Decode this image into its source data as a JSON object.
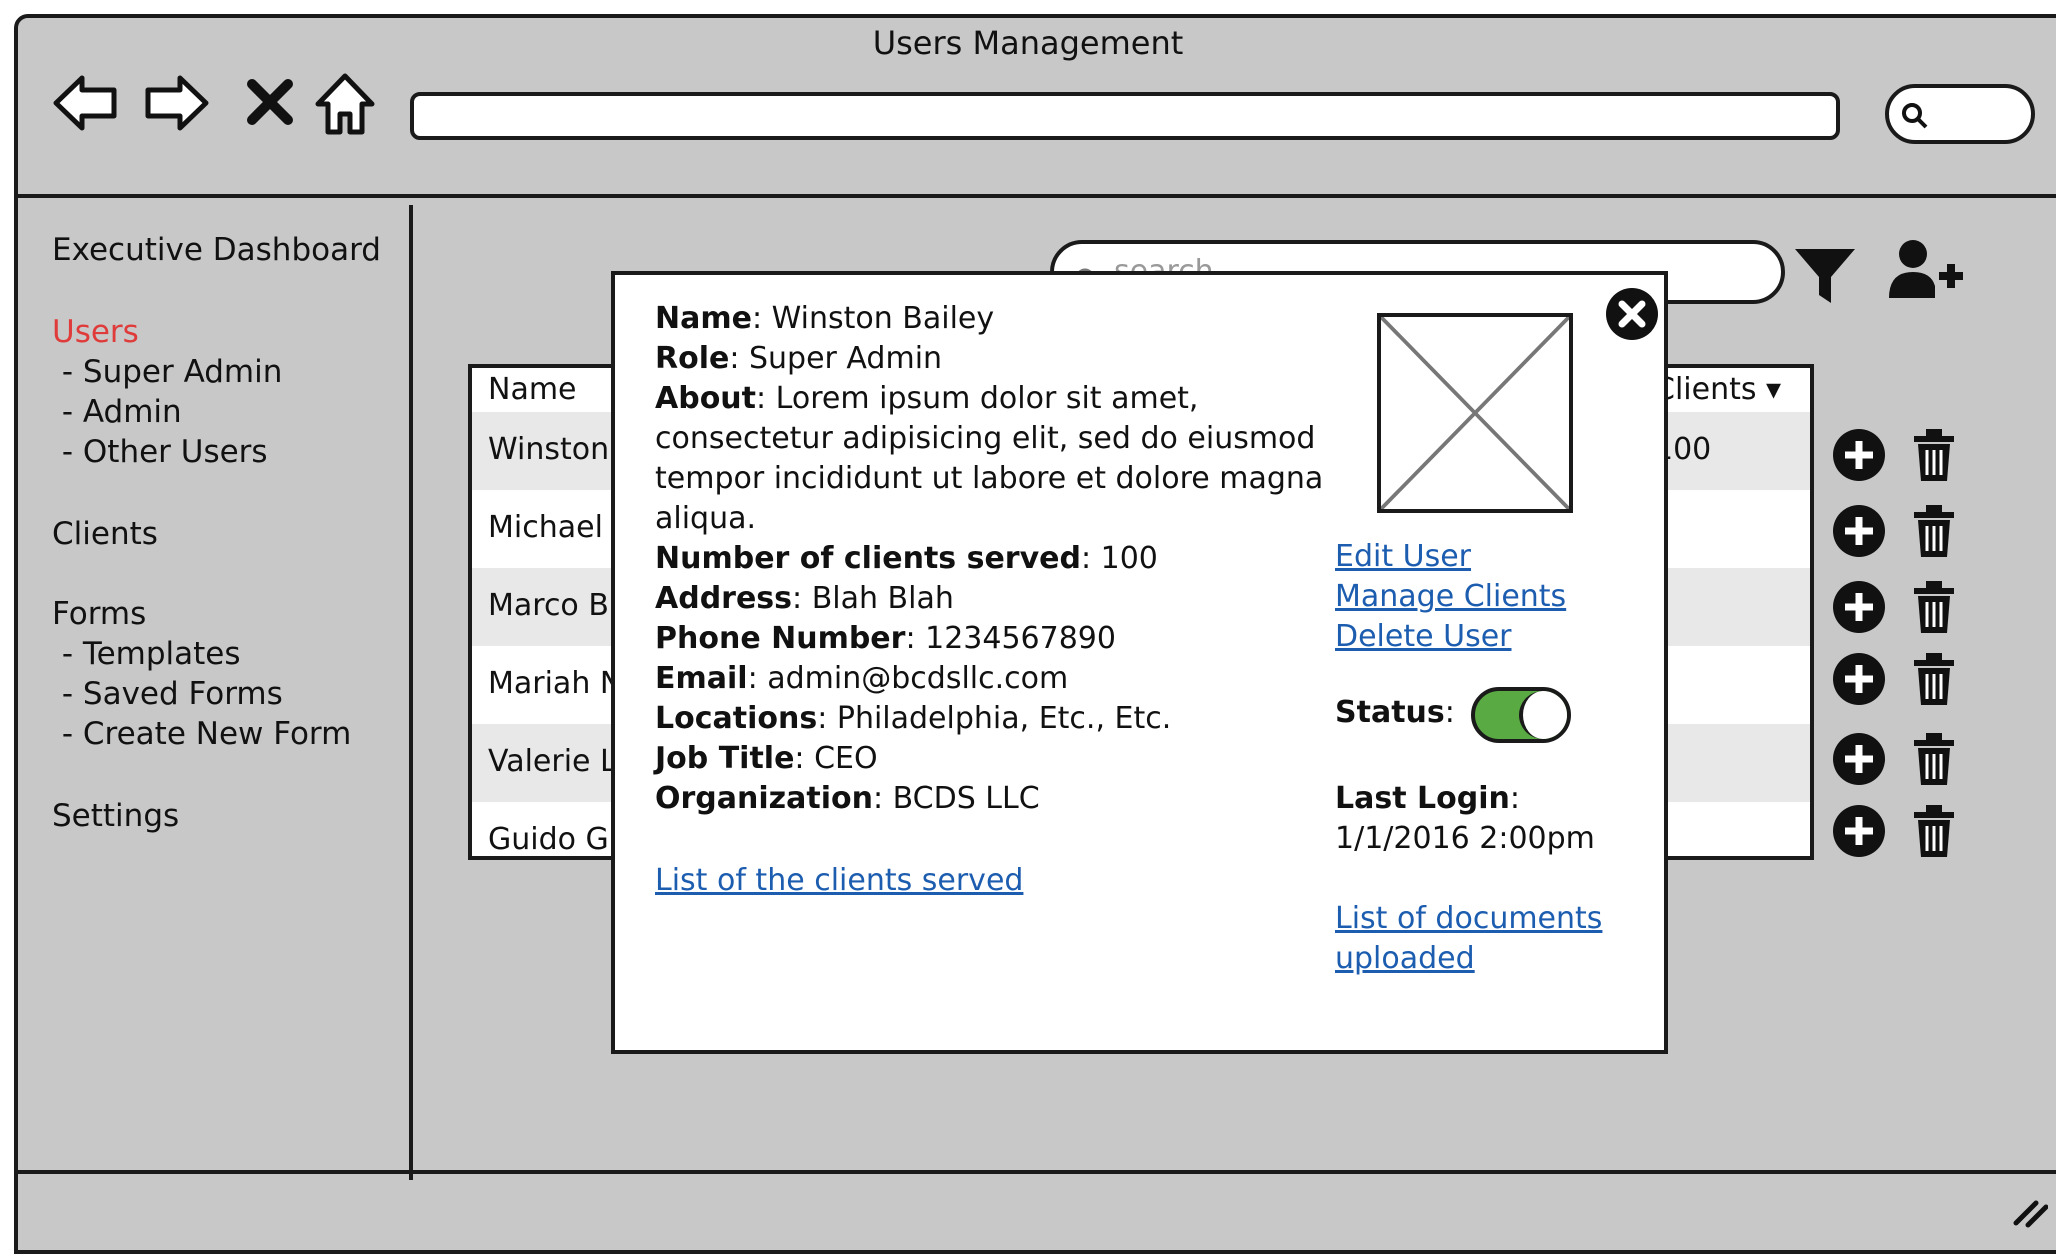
{
  "window": {
    "title": "Users Management"
  },
  "browser": {
    "address_value": "",
    "search_value": ""
  },
  "sidebar": {
    "items": [
      {
        "label": "Executive Dashboard"
      },
      {
        "label": "Users",
        "active": true
      },
      {
        "label": " - Super Admin"
      },
      {
        "label": " - Admin"
      },
      {
        "label": " - Other Users"
      },
      {
        "label": "Clients"
      },
      {
        "label": "Forms"
      },
      {
        "label": " - Templates"
      },
      {
        "label": " - Saved Forms"
      },
      {
        "label": " - Create New Form"
      },
      {
        "label": "Settings"
      }
    ]
  },
  "main": {
    "search_placeholder": "search",
    "table": {
      "headers": {
        "name": "Name",
        "clients": "Clients"
      },
      "rows": [
        {
          "name": "Winston",
          "clients": "100"
        },
        {
          "name": "Michael",
          "clients": ""
        },
        {
          "name": "Marco B",
          "clients": ""
        },
        {
          "name": "Mariah N",
          "clients": ""
        },
        {
          "name": "Valerie L",
          "clients": ""
        },
        {
          "name": "Guido G",
          "clients": ""
        }
      ]
    }
  },
  "modal": {
    "fields": [
      {
        "label": "Name",
        "value": "Winston Bailey"
      },
      {
        "label": "Role",
        "value": "Super Admin"
      },
      {
        "label": "About",
        "value": "Lorem ipsum dolor sit amet, consectetur adipisicing elit, sed do eiusmod tempor incididunt ut labore et dolore magna aliqua."
      },
      {
        "label": "Number of clients served",
        "value": "100"
      },
      {
        "label": "Address",
        "value": "Blah Blah"
      },
      {
        "label": "Phone Number",
        "value": "1234567890"
      },
      {
        "label": "Email",
        "value": "admin@bcdsllc.com"
      },
      {
        "label": "Locations",
        "value": "Philadelphia, Etc., Etc."
      },
      {
        "label": "Job Title",
        "value": "CEO"
      },
      {
        "label": "Organization",
        "value": "BCDS LLC"
      }
    ],
    "clients_link": "List of the clients served",
    "actions": {
      "edit": "Edit User",
      "manage": "Manage Clients",
      "delete": "Delete User"
    },
    "status": {
      "label": "Status",
      "on": true
    },
    "last_login": {
      "label": "Last Login",
      "value": "1/1/2016 2:00pm"
    },
    "documents_link": "List of documents uploaded"
  },
  "colors": {
    "active_nav": "#e03b3b",
    "link": "#1c5db0",
    "toggle_on": "#5aaa44",
    "window_bg": "#c8c8c8"
  }
}
